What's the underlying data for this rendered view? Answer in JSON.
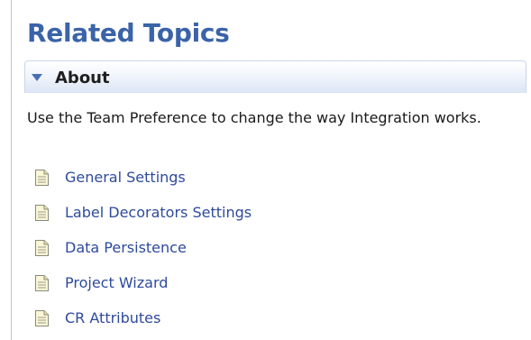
{
  "page": {
    "title": "Related Topics"
  },
  "section": {
    "title": "About",
    "toggle_icon": "triangle-down-icon",
    "expanded": true,
    "description": "Use the Team Preference to change the way Integration works."
  },
  "links": [
    {
      "label": "General Settings",
      "icon": "document-icon"
    },
    {
      "label": "Label Decorators Settings",
      "icon": "document-icon"
    },
    {
      "label": "Data Persistence",
      "icon": "document-icon"
    },
    {
      "label": "Project Wizard",
      "icon": "document-icon"
    },
    {
      "label": "CR Attributes",
      "icon": "document-icon"
    }
  ],
  "colors": {
    "title": "#3a63a8",
    "link": "#2e4a9c",
    "toggle": "#4a6fb5",
    "section_header_bottom": "#dbe5f5"
  }
}
